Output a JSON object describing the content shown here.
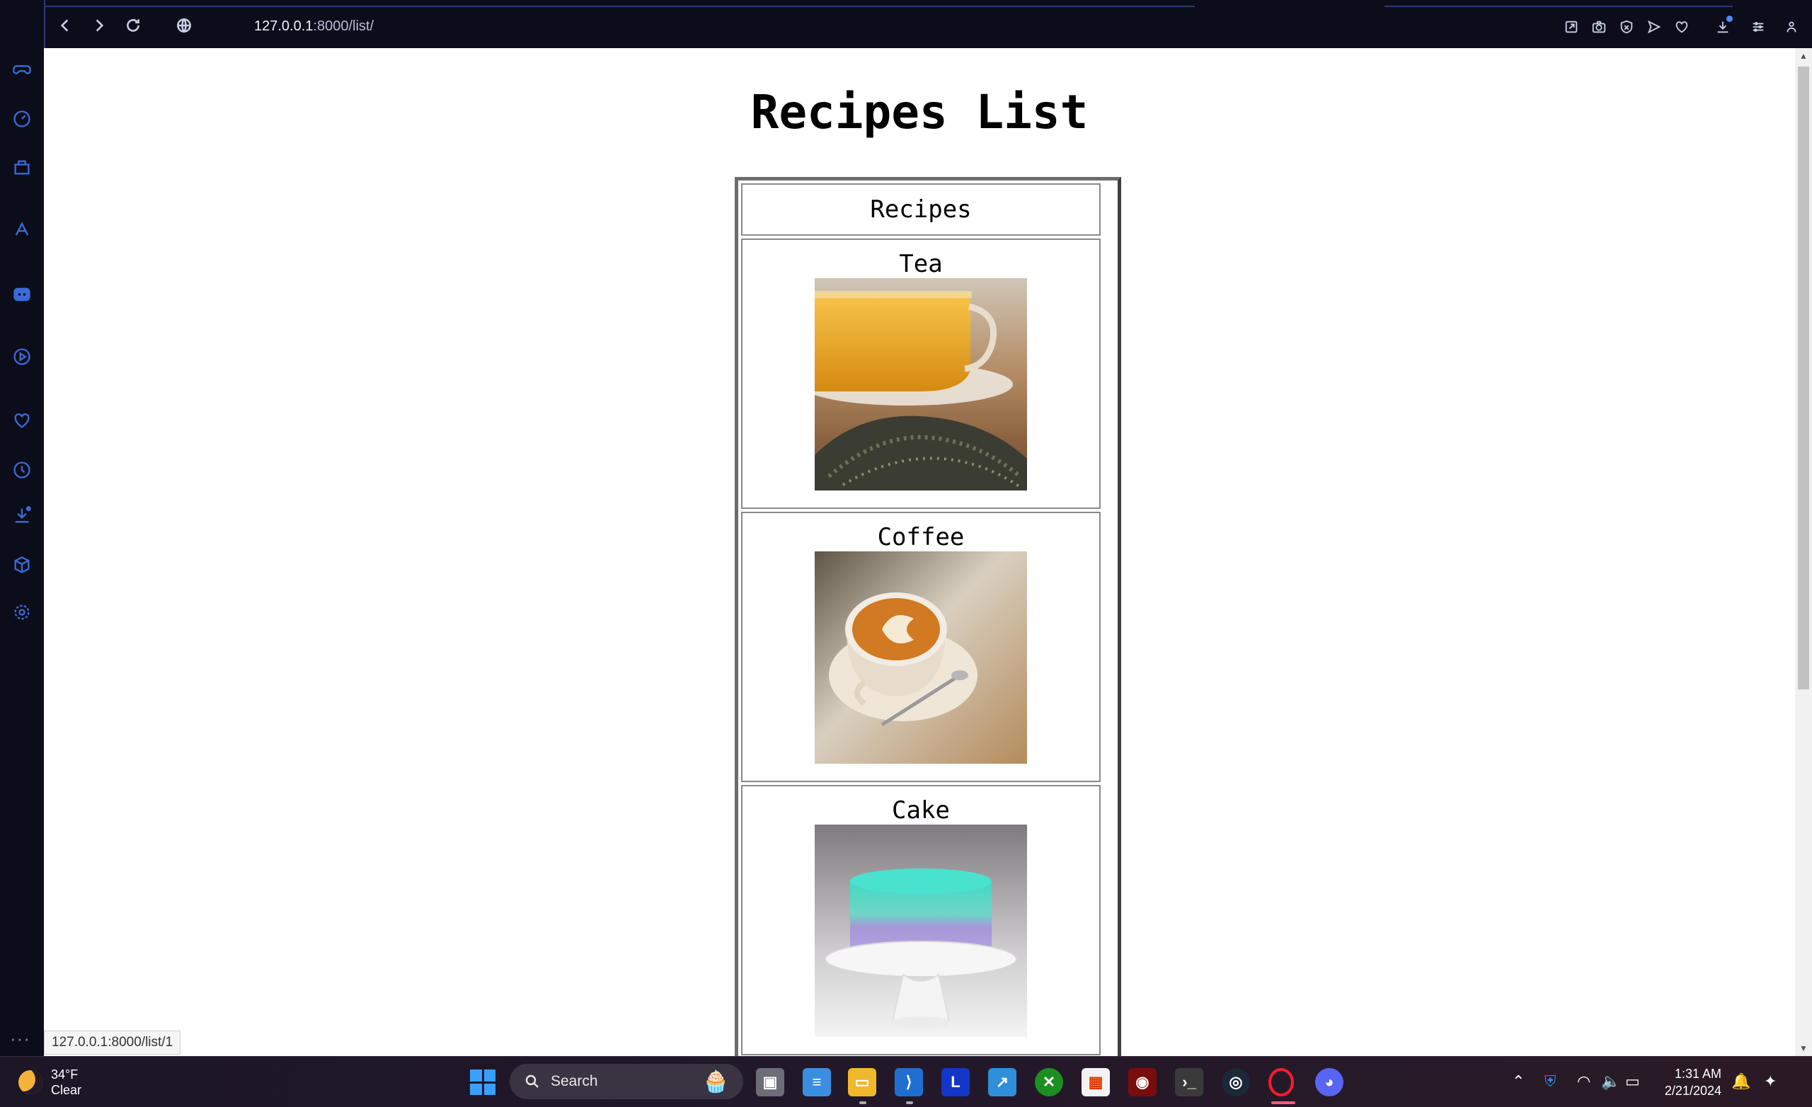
{
  "browser": {
    "url_host": "127.0.0.1",
    "url_path": ":8000/list/",
    "status_url": "127.0.0.1:8000/list/1"
  },
  "sidebar": {
    "items": [
      "gamepad",
      "speed-dial",
      "workspaces",
      "aria",
      "discord",
      "player",
      "favorites",
      "history",
      "downloads",
      "extensions",
      "settings"
    ],
    "more": "···"
  },
  "page": {
    "title": "Recipes List",
    "table_header": "Recipes",
    "recipes": [
      {
        "name": "Tea",
        "image": "tea-photo"
      },
      {
        "name": "Coffee",
        "image": "coffee-photo"
      },
      {
        "name": "Cake",
        "image": "cake-photo"
      }
    ]
  },
  "taskbar": {
    "weather_temp": "34°F",
    "weather_desc": "Clear",
    "search_label": "Search",
    "apps": [
      "task-view",
      "notepad",
      "file-explorer",
      "vscode",
      "launcher",
      "app-installer",
      "xbox",
      "ms-store",
      "game-app",
      "terminal",
      "steam",
      "opera",
      "discord"
    ],
    "time": "1:31 AM",
    "date": "2/21/2024"
  },
  "colors": {
    "sidebar_icon": "#3b6bd6",
    "windows_blue": "#3aa0ff",
    "opera_red": "#ff1b2d"
  }
}
